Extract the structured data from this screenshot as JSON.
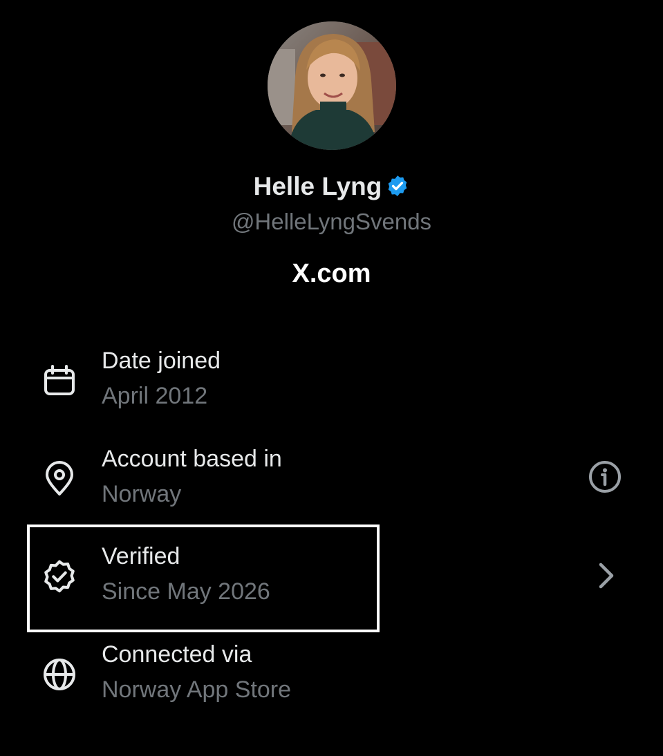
{
  "profile": {
    "display_name": "Helle Lyng",
    "handle": "@HelleLyngSvends",
    "site": "X.com",
    "verified_badge_icon": "verified-badge-icon",
    "badge_color": "#1d9bf0"
  },
  "details": {
    "date_joined": {
      "label": "Date joined",
      "value": "April 2012",
      "icon": "calendar-icon"
    },
    "account_based_in": {
      "label": "Account based in",
      "value": "Norway",
      "icon": "location-pin-icon",
      "action_icon": "info-icon"
    },
    "verified": {
      "label": "Verified",
      "value": "Since May 2026",
      "icon": "verified-seal-icon",
      "action_icon": "chevron-right-icon",
      "highlighted": true
    },
    "connected_via": {
      "label": "Connected via",
      "value": "Norway App Store",
      "icon": "globe-icon"
    }
  },
  "colors": {
    "background": "#000000",
    "primary_text": "#e7e9ea",
    "secondary_text": "#71767b",
    "highlight_border": "#ffffff"
  }
}
